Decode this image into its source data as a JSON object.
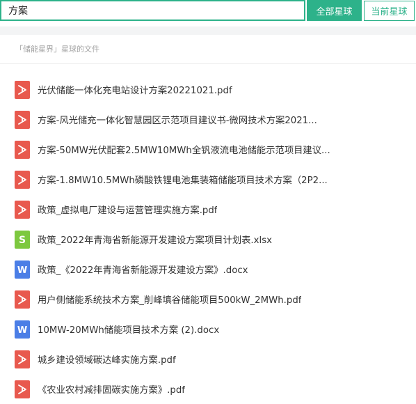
{
  "search": {
    "value": "方案",
    "placeholder": ""
  },
  "buttons": {
    "all_planets": "全部星球",
    "current_planet": "当前星球"
  },
  "scope_label": "「储能星界」星球的文件",
  "files": [
    {
      "type": "pdf",
      "name": "光伏储能一体化充电站设计方案20221021.pdf"
    },
    {
      "type": "pdf",
      "name": "方案-风光储充一体化智慧园区示范项目建议书-微网技术方案2021..."
    },
    {
      "type": "pdf",
      "name": "方案-50MW光伏配套2.5MW10MWh全钒液流电池储能示范项目建议..."
    },
    {
      "type": "pdf",
      "name": "方案-1.8MW10.5MWh磷酸铁锂电池集装箱储能项目技术方案（2P2..."
    },
    {
      "type": "pdf",
      "name": "政策_虚拟电厂建设与运营管理实施方案.pdf"
    },
    {
      "type": "xlsx",
      "name": "政策_2022年青海省新能源开发建设方案项目计划表.xlsx"
    },
    {
      "type": "docx",
      "name": "政策_《2022年青海省新能源开发建设方案》.docx"
    },
    {
      "type": "pdf",
      "name": "用户侧储能系统技术方案_削峰填谷储能项目500kW_2MWh.pdf"
    },
    {
      "type": "docx",
      "name": "10MW-20MWh储能项目技术方案 (2).docx"
    },
    {
      "type": "pdf",
      "name": "城乡建设领域碳达峰实施方案.pdf"
    },
    {
      "type": "pdf",
      "name": "《农业农村减排固碳实施方案》.pdf"
    }
  ],
  "icons": {
    "pdf": "pdf-file-icon",
    "xlsx": "excel-file-icon",
    "docx": "word-file-icon"
  },
  "colors": {
    "accent": "#2db28a",
    "pdf": "#e8594e",
    "xlsx": "#7dc83f",
    "docx": "#4b7ee6"
  }
}
